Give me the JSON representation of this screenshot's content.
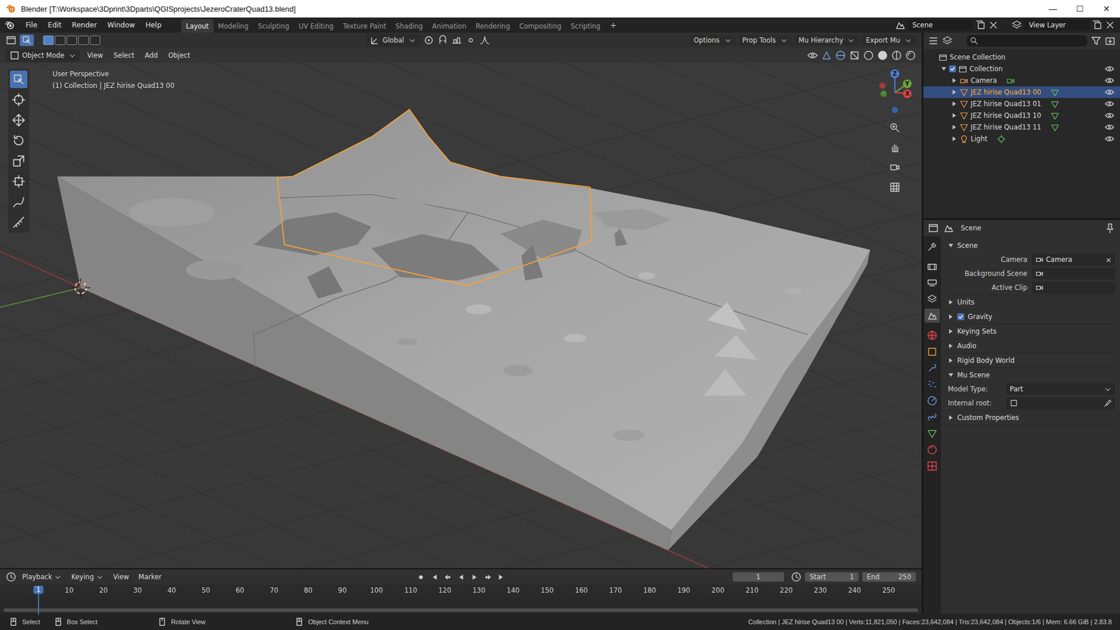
{
  "window": {
    "title": "Blender [T:\\Workspace\\3Dprint\\3Dparts\\QGISprojects\\JezeroCraterQuad13.blend]",
    "controls": [
      "—",
      "☐",
      "✕"
    ]
  },
  "menus": [
    "File",
    "Edit",
    "Render",
    "Window",
    "Help"
  ],
  "workspaces": [
    {
      "label": "Layout",
      "selected": true
    },
    {
      "label": "Modeling",
      "selected": false
    },
    {
      "label": "Sculpting",
      "selected": false
    },
    {
      "label": "UV Editing",
      "selected": false
    },
    {
      "label": "Texture Paint",
      "selected": false
    },
    {
      "label": "Shading",
      "selected": false
    },
    {
      "label": "Animation",
      "selected": false
    },
    {
      "label": "Rendering",
      "selected": false
    },
    {
      "label": "Compositing",
      "selected": false
    },
    {
      "label": "Scripting",
      "selected": false
    }
  ],
  "add_workspace": "+",
  "scene_selector": {
    "value": "Scene"
  },
  "view_layer": {
    "value": "View Layer"
  },
  "viewport": {
    "orientation": "Global",
    "tool_menus": [
      "Options",
      "Prop Tools",
      "Mu Hierarchy",
      "Export Mu"
    ],
    "mode": "Object Mode",
    "menus": [
      "View",
      "Select",
      "Add",
      "Object"
    ],
    "overlay": [
      "User Perspective",
      "(1) Collection | JEZ hirise Quad13 00"
    ],
    "axes": [
      "X",
      "Y",
      "Z"
    ],
    "tools": [
      {
        "kind": "select_box",
        "selected": true
      },
      {
        "kind": "cursor",
        "selected": false
      },
      {
        "kind": "move",
        "selected": false
      },
      {
        "kind": "rotate",
        "selected": false
      },
      {
        "kind": "scale",
        "selected": false
      },
      {
        "kind": "transform",
        "selected": false
      },
      {
        "kind": "annotate",
        "selected": false
      },
      {
        "kind": "measure",
        "selected": false
      }
    ]
  },
  "outliner": {
    "search": "",
    "items": [
      {
        "label": "Scene Collection",
        "kind": "scene_collection",
        "depth": 0,
        "selected": false
      },
      {
        "label": "Collection",
        "kind": "collection",
        "depth": 1,
        "expanded": true,
        "checked": true,
        "visible": true,
        "selected": false
      },
      {
        "label": "Camera",
        "kind": "camera",
        "depth": 2,
        "expanded": false,
        "visible": true,
        "selected": false
      },
      {
        "label": "JEZ hirise Quad13 00",
        "kind": "mesh",
        "depth": 2,
        "expanded": false,
        "visible": true,
        "selected": true
      },
      {
        "label": "JEZ hirise Quad13 01",
        "kind": "mesh",
        "depth": 2,
        "expanded": false,
        "visible": true,
        "selected": false
      },
      {
        "label": "JEZ hirise Quad13 10",
        "kind": "mesh",
        "depth": 2,
        "expanded": false,
        "visible": true,
        "selected": false
      },
      {
        "label": "JEZ hirise Quad13 11",
        "kind": "mesh",
        "depth": 2,
        "expanded": false,
        "visible": true,
        "selected": false
      },
      {
        "label": "Light",
        "kind": "light",
        "depth": 2,
        "expanded": false,
        "visible": true,
        "selected": false
      }
    ]
  },
  "properties": {
    "context": "Scene",
    "tabs": [
      {
        "kind": "tool",
        "selected": false
      },
      {
        "kind": "render",
        "selected": false
      },
      {
        "kind": "output",
        "selected": false
      },
      {
        "kind": "view_layer",
        "selected": false
      },
      {
        "kind": "scene",
        "selected": true
      },
      {
        "kind": "world",
        "selected": false
      },
      {
        "kind": "object",
        "selected": false
      },
      {
        "kind": "modifiers",
        "selected": false
      },
      {
        "kind": "particles",
        "selected": false
      },
      {
        "kind": "physics",
        "selected": false
      },
      {
        "kind": "constraints",
        "selected": false
      },
      {
        "kind": "data",
        "selected": false
      },
      {
        "kind": "material",
        "selected": false
      },
      {
        "kind": "texture",
        "selected": false
      }
    ],
    "sections": [
      {
        "title": "Scene",
        "expanded": true,
        "rows": [
          {
            "kind": "object_field",
            "label": "Camera",
            "value": "Camera",
            "clear": "×"
          },
          {
            "kind": "object_field",
            "label": "Background Scene",
            "value": ""
          },
          {
            "kind": "object_field",
            "label": "Active Clip",
            "value": ""
          }
        ]
      },
      {
        "title": "Units",
        "expanded": false
      },
      {
        "title": "Gravity",
        "expanded": false,
        "checked": true
      },
      {
        "title": "Keying Sets",
        "expanded": false
      },
      {
        "title": "Audio",
        "expanded": false
      },
      {
        "title": "Rigid Body World",
        "expanded": false
      },
      {
        "title": "Mu Scene",
        "expanded": true,
        "rows": [
          {
            "kind": "dropdown",
            "label": "Model Type:",
            "value": "Part"
          },
          {
            "kind": "picker",
            "label": "Internal root:",
            "value": ""
          }
        ]
      },
      {
        "title": "Custom Properties",
        "expanded": false
      }
    ]
  },
  "timeline": {
    "menus": [
      "Playback",
      "Keying",
      "View",
      "Marker"
    ],
    "frame": "1",
    "start_label": "Start",
    "start": "1",
    "end_label": "End",
    "end": "250",
    "current": "1",
    "ticks": [
      "10",
      "20",
      "30",
      "40",
      "50",
      "60",
      "70",
      "80",
      "90",
      "100",
      "110",
      "120",
      "130",
      "140",
      "150",
      "160",
      "170",
      "180",
      "190",
      "200",
      "210",
      "220",
      "230",
      "240",
      "250"
    ]
  },
  "status_bar": {
    "hints": [
      "Select",
      "Box Select",
      "Rotate View",
      "Object Context Menu"
    ],
    "stats": "Collection | JEZ hirise Quad13 00 | Verts:11,821,050 | Faces:23,642,084 | Tris:23,642,084 | Objects:1/6 | Mem: 6.66 GiB | 2.83.8"
  }
}
